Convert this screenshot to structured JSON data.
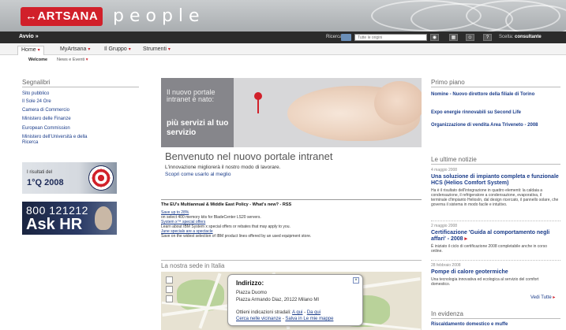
{
  "header": {
    "logo_text": "↔ARTSANA",
    "brand_word": "people"
  },
  "toolbar": {
    "avvio": "Avvio »",
    "search_label": "Ricerca",
    "search_placeholder": "Tutte le origini",
    "btn1": "◉",
    "btn2": "▦",
    "btn3": "☺",
    "btn4": "?",
    "theme_label": "Scelta:",
    "theme_value": "consultante"
  },
  "nav": {
    "tabs": [
      {
        "label": "Home",
        "arrow": "▾"
      },
      {
        "label": "MyArtsana",
        "arrow": "▾"
      },
      {
        "label": "Il Gruppo",
        "arrow": "▾"
      },
      {
        "label": "Strumenti",
        "arrow": "▾"
      }
    ],
    "subtabs": [
      {
        "label": "Welcome"
      },
      {
        "label": "News e Eventi",
        "arrow": "▾"
      }
    ]
  },
  "left": {
    "title": "Segnalibri",
    "links": [
      "Sito pubblico",
      "Il Sole 24 Ore",
      "Camera di Commercio",
      "Ministero delle Finanze",
      "European Commission",
      "Ministero dell'Università e della",
      "Ricerca"
    ],
    "banner1_line1": "I risultati del",
    "banner1_line2": "1°Q 2008",
    "banner2_line1": "800 121212",
    "banner2_line2": "Ask HR"
  },
  "hero": {
    "line1": "Il nuovo portale intranet è nato:",
    "line2": "più servizi al tuo servizio",
    "welcome_title": "Benvenuto nel nuovo portale intranet",
    "welcome_sub": "L'innovazione migliorerà il nostro modo di lavorare.",
    "welcome_link": "Scopri come usarlo al meglio"
  },
  "news": {
    "head": "The EU's Multiannual & Middle East Policy - What's new? - RSS",
    "lines": [
      {
        "text": "Save up to 28%",
        "link": true
      },
      {
        "text": "on select 400 memory kits for BladeCenter LS20 servers.",
        "link": false
      },
      {
        "text": "System x™ special offers",
        "link": true
      },
      {
        "text": "Learn about IBM System x special offers or rebates that may apply to you.",
        "link": false
      },
      {
        "text": "June specials are a spectacle",
        "link": true
      },
      {
        "text": "Save on the widest selection of IBM product lines offered by an used equipment store.",
        "link": false
      }
    ]
  },
  "map": {
    "title": "La nostra sede in Italia",
    "popup_title": "Indirizzo:",
    "line1": "Piazza Duomo",
    "line2": "Piazza Armando Diaz, 20122 Milano MI",
    "directions_label": "Ottieni indicazioni stradali:",
    "to_here": "A qui",
    "from_here": "Da qui",
    "nearby": "Cerca nelle vicinanze",
    "save": "Salva in Le mie mappe",
    "sep": "-",
    "close": "×"
  },
  "right": {
    "primo_title": "Primo piano",
    "primo_items": [
      "Nomine - Nuovo direttore della filiale di Torino",
      "Expo energie rinnovabili su Second Life",
      "Organizzazione di vendita Area Triveneto - 2008"
    ],
    "notizie_title": "Le ultime notizie",
    "notizie": [
      {
        "date": "4 maggio 2008",
        "head": "Una soluzione di impianto completa e funzionale HCS (Helios Comfort System)",
        "body": "Ha è il risultato dell'integrazione in quattro elementi: la caldaia a condensazione, il refrigeratore a condensazione, evaporativa, il terminale d'impianto HeliosIn, dal design ricercato, il pannello solare, che governa il sistema in modo facile e intuitivo."
      },
      {
        "date": "2 maggio 2008",
        "head": "Certificazione 'Guida al comportamento negli affari' - 2008",
        "body": "È iniziato il ciclo di certificazione 2008 completabile anche in corso online."
      },
      {
        "date": "28 febbraio 2008",
        "head": "Pompe di calore geotermiche",
        "body": "Una tecnologia innovativa ed ecologica al servizio del comfort domestico."
      }
    ],
    "view_all": "Vedi Tutte",
    "evidenza_title": "In evidenza",
    "evidenza_item": "Riscaldamento domestico e muffe"
  }
}
